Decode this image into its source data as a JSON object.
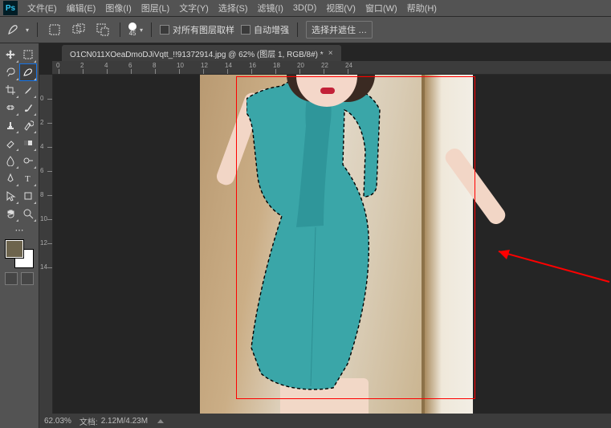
{
  "menu": {
    "file": "文件(E)",
    "edit": "编辑(E)",
    "image": "图像(I)",
    "layer": "图层(L)",
    "type": "文字(Y)",
    "select": "选择(S)",
    "filter": "滤镜(I)",
    "threeD": "3D(D)",
    "view": "视图(V)",
    "window": "窗口(W)",
    "help": "帮助(H)"
  },
  "options": {
    "brushSize": "45",
    "sampleAll": "对所有图层取样",
    "autoEnhance": "自动增强",
    "selectMask": "选择并遮住 …"
  },
  "tab": {
    "title": "O1CN011XOeaDmoDJiVqtt_!!91372914.jpg @ 62% (图层 1, RGB/8#) *"
  },
  "rulerH": [
    "0",
    "2",
    "4",
    "6",
    "8",
    "10",
    "12",
    "14",
    "16",
    "18",
    "20",
    "22",
    "24"
  ],
  "rulerV": [
    "0",
    "2",
    "4",
    "6",
    "8",
    "10",
    "12",
    "14"
  ],
  "status": {
    "zoom": "62.03%",
    "docLabel": "文档:",
    "docSize": "2.12M/4.23M"
  },
  "colors": {
    "dress": "#3aa6a8",
    "accent": "#ff0000"
  }
}
